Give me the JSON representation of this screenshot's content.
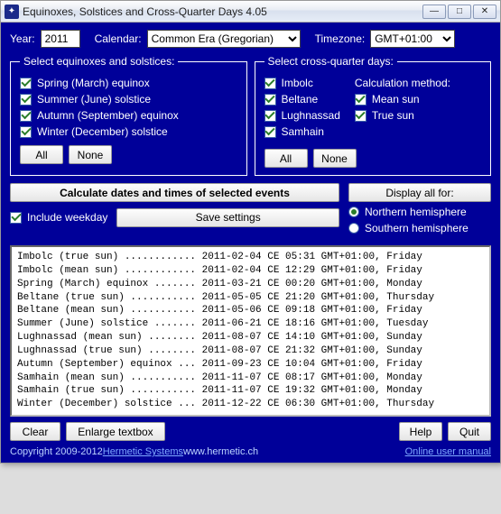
{
  "window": {
    "title": "Equinoxes, Solstices and Cross-Quarter Days 4.05"
  },
  "inputs": {
    "year_label": "Year:",
    "year_value": "2011",
    "calendar_label": "Calendar:",
    "calendar_value": "Common Era (Gregorian)",
    "timezone_label": "Timezone:",
    "timezone_value": "GMT+01:00"
  },
  "equinox_group": {
    "legend": "Select equinoxes and solstices:",
    "items": [
      {
        "label": "Spring (March) equinox",
        "checked": true
      },
      {
        "label": "Summer (June) solstice",
        "checked": true
      },
      {
        "label": "Autumn (September) equinox",
        "checked": true
      },
      {
        "label": "Winter (December) solstice",
        "checked": true
      }
    ],
    "all_btn": "All",
    "none_btn": "None"
  },
  "crossquarter_group": {
    "legend": "Select cross-quarter days:",
    "items": [
      {
        "label": "Imbolc",
        "checked": true
      },
      {
        "label": "Beltane",
        "checked": true
      },
      {
        "label": "Lughnassad",
        "checked": true
      },
      {
        "label": "Samhain",
        "checked": true
      }
    ],
    "method_label": "Calculation method:",
    "method_items": [
      {
        "label": "Mean sun",
        "checked": true
      },
      {
        "label": "True sun",
        "checked": true
      }
    ],
    "all_btn": "All",
    "none_btn": "None"
  },
  "actions": {
    "calculate": "Calculate dates and times of selected events",
    "display_all": "Display all for:",
    "hemi_north": "Northern hemisphere",
    "hemi_south": "Southern hemisphere",
    "hemi_selected": "north",
    "include_weekday": {
      "label": "Include weekday",
      "checked": true
    },
    "save_settings": "Save settings"
  },
  "output_lines": [
    "Imbolc (true sun) ............ 2011-02-04 CE 05:31 GMT+01:00, Friday",
    "Imbolc (mean sun) ............ 2011-02-04 CE 12:29 GMT+01:00, Friday",
    "Spring (March) equinox ....... 2011-03-21 CE 00:20 GMT+01:00, Monday",
    "Beltane (true sun) ........... 2011-05-05 CE 21:20 GMT+01:00, Thursday",
    "Beltane (mean sun) ........... 2011-05-06 CE 09:18 GMT+01:00, Friday",
    "Summer (June) solstice ....... 2011-06-21 CE 18:16 GMT+01:00, Tuesday",
    "Lughnassad (mean sun) ........ 2011-08-07 CE 14:10 GMT+01:00, Sunday",
    "Lughnassad (true sun) ........ 2011-08-07 CE 21:32 GMT+01:00, Sunday",
    "Autumn (September) equinox ... 2011-09-23 CE 10:04 GMT+01:00, Friday",
    "Samhain (mean sun) ........... 2011-11-07 CE 08:17 GMT+01:00, Monday",
    "Samhain (true sun) ........... 2011-11-07 CE 19:32 GMT+01:00, Monday",
    "Winter (December) solstice ... 2011-12-22 CE 06:30 GMT+01:00, Thursday"
  ],
  "bottom": {
    "clear": "Clear",
    "enlarge": "Enlarge textbox",
    "help": "Help",
    "quit": "Quit"
  },
  "footer": {
    "copyright": "Copyright 2009-2012 ",
    "company": "Hermetic Systems",
    "url_text": " www.hermetic.ch",
    "manual": "Online user manual"
  }
}
